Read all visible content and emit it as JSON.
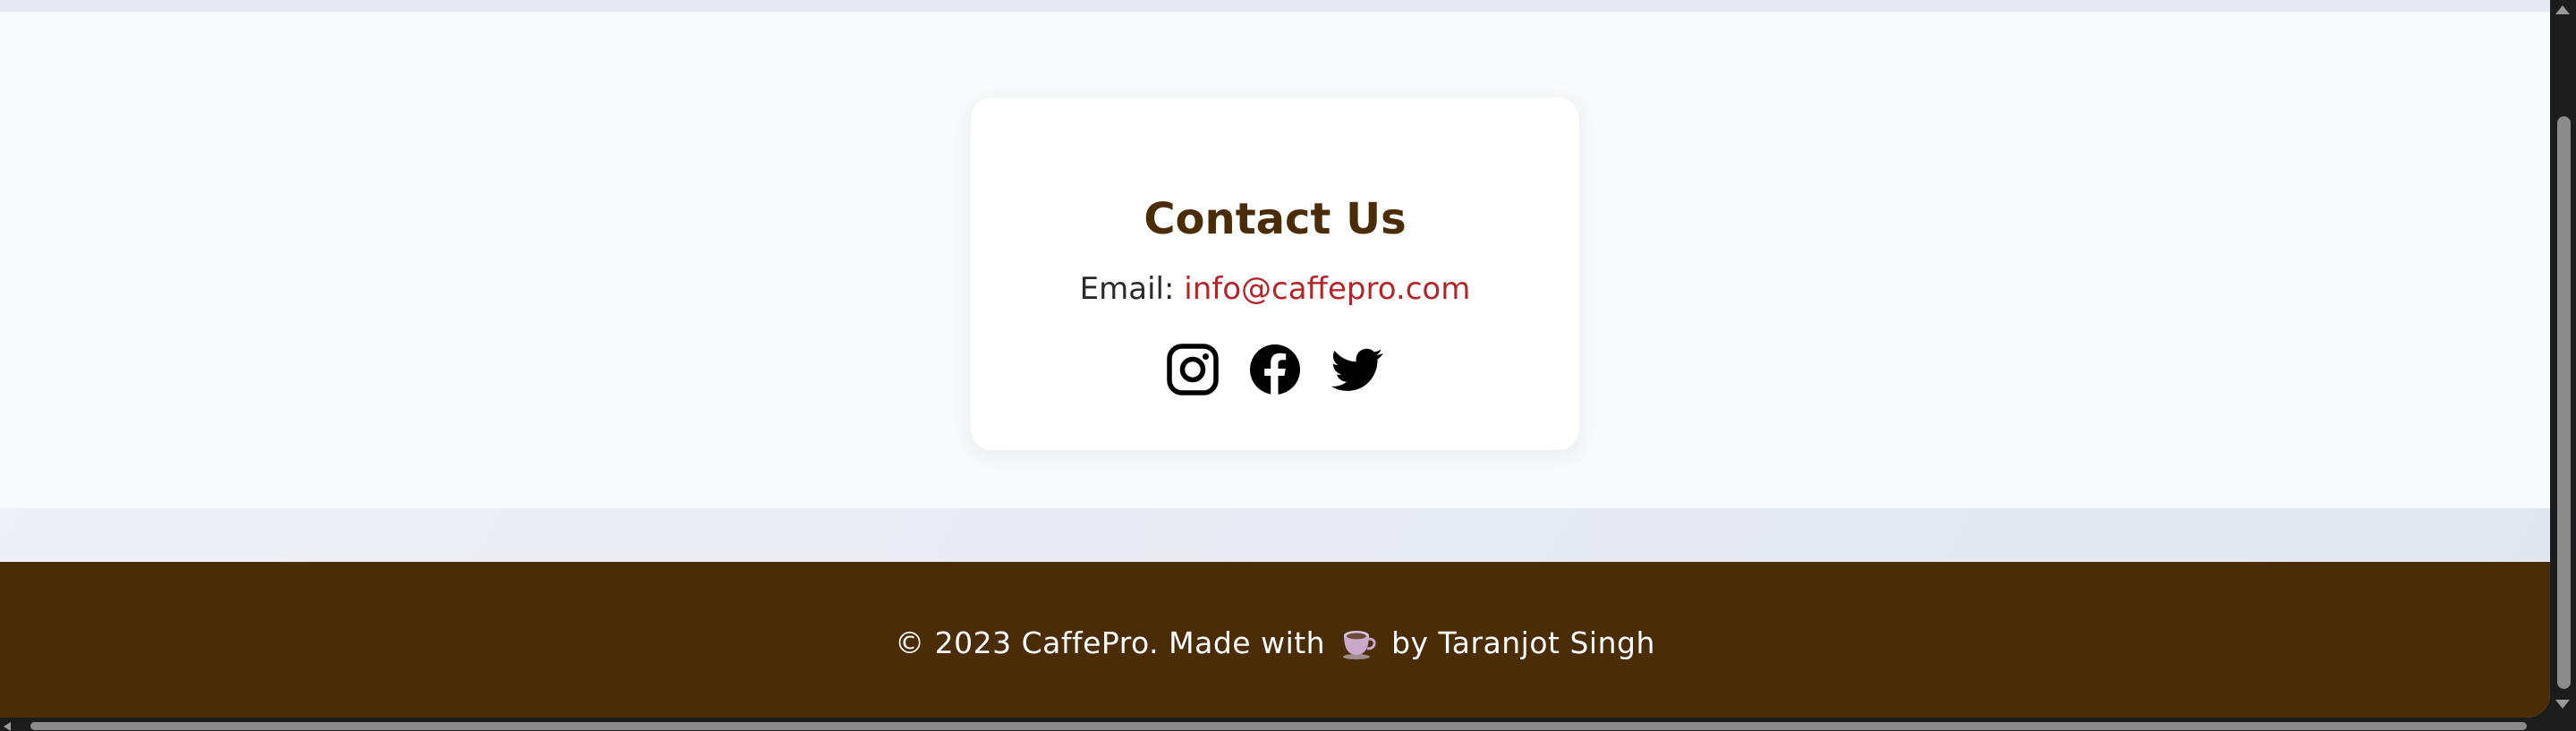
{
  "contact": {
    "title": "Contact Us",
    "email_label": "Email:",
    "email_address": "info@caffepro.com",
    "social": [
      {
        "name": "instagram",
        "icon": "instagram-icon"
      },
      {
        "name": "facebook",
        "icon": "facebook-icon"
      },
      {
        "name": "twitter",
        "icon": "twitter-icon"
      }
    ]
  },
  "footer": {
    "text_before": "© 2023 CaffePro. Made with",
    "icon": "coffee-cup-icon",
    "text_after": "by Taranjot Singh"
  },
  "colors": {
    "title": "#4a2d07",
    "link": "#b0262b",
    "footer_bg": "#4a2c07",
    "section_bg": "#f8f9fb"
  }
}
